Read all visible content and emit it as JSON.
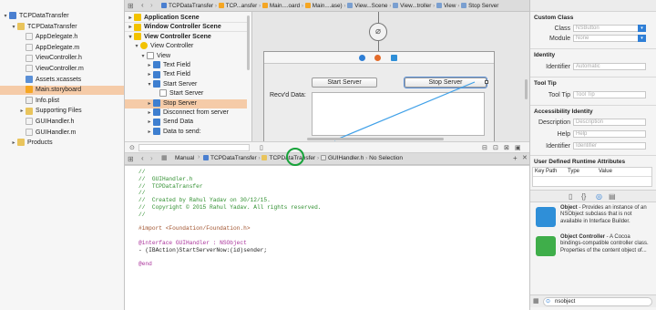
{
  "navigator": {
    "items": [
      {
        "label": "TCPDataTransfer",
        "level": 0,
        "icon": "project-icon",
        "tri": "▾"
      },
      {
        "label": "TCPDataTransfer",
        "level": 1,
        "icon": "folder-icon",
        "tri": "▾"
      },
      {
        "label": "AppDelegate.h",
        "level": 2,
        "icon": "header-file-icon",
        "tri": ""
      },
      {
        "label": "AppDelegate.m",
        "level": 2,
        "icon": "source-file-icon",
        "tri": ""
      },
      {
        "label": "ViewController.h",
        "level": 2,
        "icon": "header-file-icon",
        "tri": ""
      },
      {
        "label": "ViewController.m",
        "level": 2,
        "icon": "source-file-icon",
        "tri": ""
      },
      {
        "label": "Assets.xcassets",
        "level": 2,
        "icon": "assets-icon",
        "tri": ""
      },
      {
        "label": "Main.storyboard",
        "level": 2,
        "icon": "storyboard-icon",
        "tri": "",
        "selected": true
      },
      {
        "label": "Info.plist",
        "level": 2,
        "icon": "plist-icon",
        "tri": ""
      },
      {
        "label": "Supporting Files",
        "level": 2,
        "icon": "folder-icon",
        "tri": "▸"
      },
      {
        "label": "GUIHandler.h",
        "level": 2,
        "icon": "header-file-icon",
        "tri": ""
      },
      {
        "label": "GUIHandler.m",
        "level": 2,
        "icon": "source-file-icon",
        "tri": ""
      },
      {
        "label": "Products",
        "level": 1,
        "icon": "folder-icon",
        "tri": "▸"
      }
    ]
  },
  "top_jumpbar": {
    "crumbs": [
      "TCPDataTransfer",
      "TCP...ansfer",
      "Main....oard",
      "Main....ase)",
      "View...Scene",
      "View...troller",
      "View",
      "Stop Server"
    ]
  },
  "outline": {
    "items": [
      {
        "label": "Application Scene",
        "level": 0,
        "tri": "▸",
        "bold": true
      },
      {
        "label": "Window Controller Scene",
        "level": 0,
        "tri": "▸",
        "bold": true
      },
      {
        "label": "View Controller Scene",
        "level": 0,
        "tri": "▾",
        "bold": true
      },
      {
        "label": "View Controller",
        "level": 1,
        "tri": "▾"
      },
      {
        "label": "View",
        "level": 2,
        "tri": "▾"
      },
      {
        "label": "Text Field",
        "level": 3,
        "tri": "▸"
      },
      {
        "label": "Text Field",
        "level": 3,
        "tri": "▸"
      },
      {
        "label": "Start Server",
        "level": 3,
        "tri": "▾"
      },
      {
        "label": "Start Server",
        "level": 4,
        "tri": ""
      },
      {
        "label": "Stop Server",
        "level": 3,
        "tri": "▸",
        "selected": true
      },
      {
        "label": "Disconnect from server",
        "level": 3,
        "tri": "▸"
      },
      {
        "label": "Send Data",
        "level": 3,
        "tri": "▸"
      },
      {
        "label": "Data to send:",
        "level": 3,
        "tri": "▸"
      }
    ]
  },
  "canvas": {
    "start_button": "Start Server",
    "stop_button": "Stop Server",
    "recvd_label": "Recv'd Data:"
  },
  "editor_jumpbar": {
    "mode": "Manual",
    "crumbs": [
      "TCPDataTransfer",
      "TCPDataTransfer",
      "GUIHandler.h",
      "No Selection"
    ]
  },
  "code": {
    "lines": [
      {
        "t": "//",
        "k": "comment"
      },
      {
        "t": "//  GUIHandler.h",
        "k": "comment"
      },
      {
        "t": "//  TCPDataTransfer",
        "k": "comment"
      },
      {
        "t": "//",
        "k": "comment"
      },
      {
        "t": "//  Created by Rahul Yadav on 30/12/15.",
        "k": "comment"
      },
      {
        "t": "//  Copyright © 2015 Rahul Yadav. All rights reserved.",
        "k": "comment"
      },
      {
        "t": "//",
        "k": "comment"
      },
      {
        "t": "",
        "k": "plain"
      },
      {
        "t": "#import <Foundation/Foundation.h>",
        "k": "import"
      },
      {
        "t": "",
        "k": "plain"
      },
      {
        "t": "@interface GUIHandler : NSObject",
        "k": "kw"
      },
      {
        "t": "- (IBAction)StartServerNow:(id)sender;",
        "k": "plain"
      },
      {
        "t": "",
        "k": "plain"
      },
      {
        "t": "@end",
        "k": "kw"
      }
    ]
  },
  "inspector": {
    "custom_class_title": "Custom Class",
    "class_label": "Class",
    "class_value": "NSButton",
    "module_label": "Module",
    "module_value": "None",
    "identity_title": "Identity",
    "identifier_label": "Identifier",
    "identifier_placeholder": "Automatic",
    "tooltip_title": "Tool Tip",
    "tooltip_label": "Tool Tip",
    "tooltip_placeholder": "Tool Tip",
    "access_title": "Accessibility Identity",
    "desc_label": "Description",
    "desc_placeholder": "Description",
    "help_label": "Help",
    "help_placeholder": "Help",
    "aid_label": "Identifier",
    "aid_placeholder": "Identifier",
    "udra_title": "User Defined Runtime Attributes",
    "col_keypath": "Key Path",
    "col_type": "Type",
    "col_value": "Value"
  },
  "library": {
    "items": [
      {
        "title": "Object",
        "desc": " - Provides an instance of an NSObject subclass that is not available in Interface Builder.",
        "color": "#2f8fd8"
      },
      {
        "title": "Object Controller",
        "desc": " - A Cocoa bindings-compatible controller class. Properties of the content object of...",
        "color": "#3fae4a"
      }
    ],
    "filter_value": "nsobject"
  }
}
